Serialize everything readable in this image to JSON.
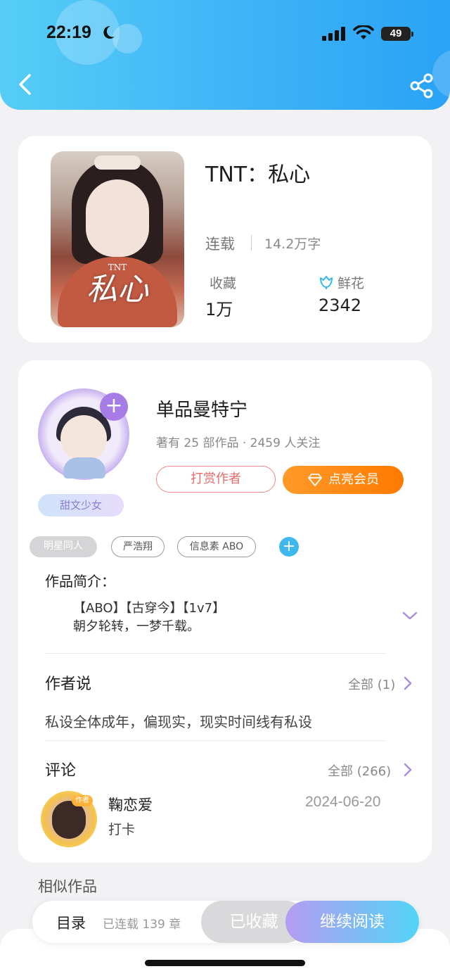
{
  "status_bar": {
    "time": "22:19",
    "battery": "49"
  },
  "header": {
    "back_icon": "chevron-left-icon",
    "share_icon": "share-icon"
  },
  "book": {
    "title": "TNT：私心",
    "cover_tnt": "TNT",
    "cover_title": "私心",
    "status": "连载",
    "word_count": "14.2万字",
    "favorites_label": "收藏",
    "favorites_value": "1万",
    "flowers_label": "鲜花",
    "flowers_value": "2342"
  },
  "author": {
    "name": "单品曼特宁",
    "stats": "著有 25 部作品 · 2459 人关注",
    "badge": "甜文少女",
    "tip_button": "打赏作者",
    "vip_button": "点亮会员",
    "follow_icon": "plus-icon"
  },
  "tags": [
    "明星同人",
    "严浩翔",
    "信息素 ABO"
  ],
  "intro": {
    "label": "作品简介：",
    "line1": "【ABO】【古穿今】【1v7】",
    "line2": "朝夕轮转，一梦千载。"
  },
  "author_say": {
    "title": "作者说",
    "more": "全部 (1)",
    "text": "私设全体成年，偏现实，现实时间线有私设"
  },
  "comments": {
    "title": "评论",
    "more": "全部 (266)",
    "items": [
      {
        "name": "鞠恋爱",
        "date": "2024-06-20",
        "text": "打卡",
        "tag": "作者"
      }
    ]
  },
  "similar_title": "相似作品",
  "bottom_bar": {
    "toc": "目录",
    "chapters": "已连载 139 章",
    "saved": "已收藏",
    "continue": "继续阅读"
  },
  "colors": {
    "header_start": "#56cdf6",
    "header_end": "#2aa3f6",
    "vip_orange": "#ff8a10",
    "tip_red": "#e56d6d",
    "accent_purple": "#a77ce6"
  }
}
